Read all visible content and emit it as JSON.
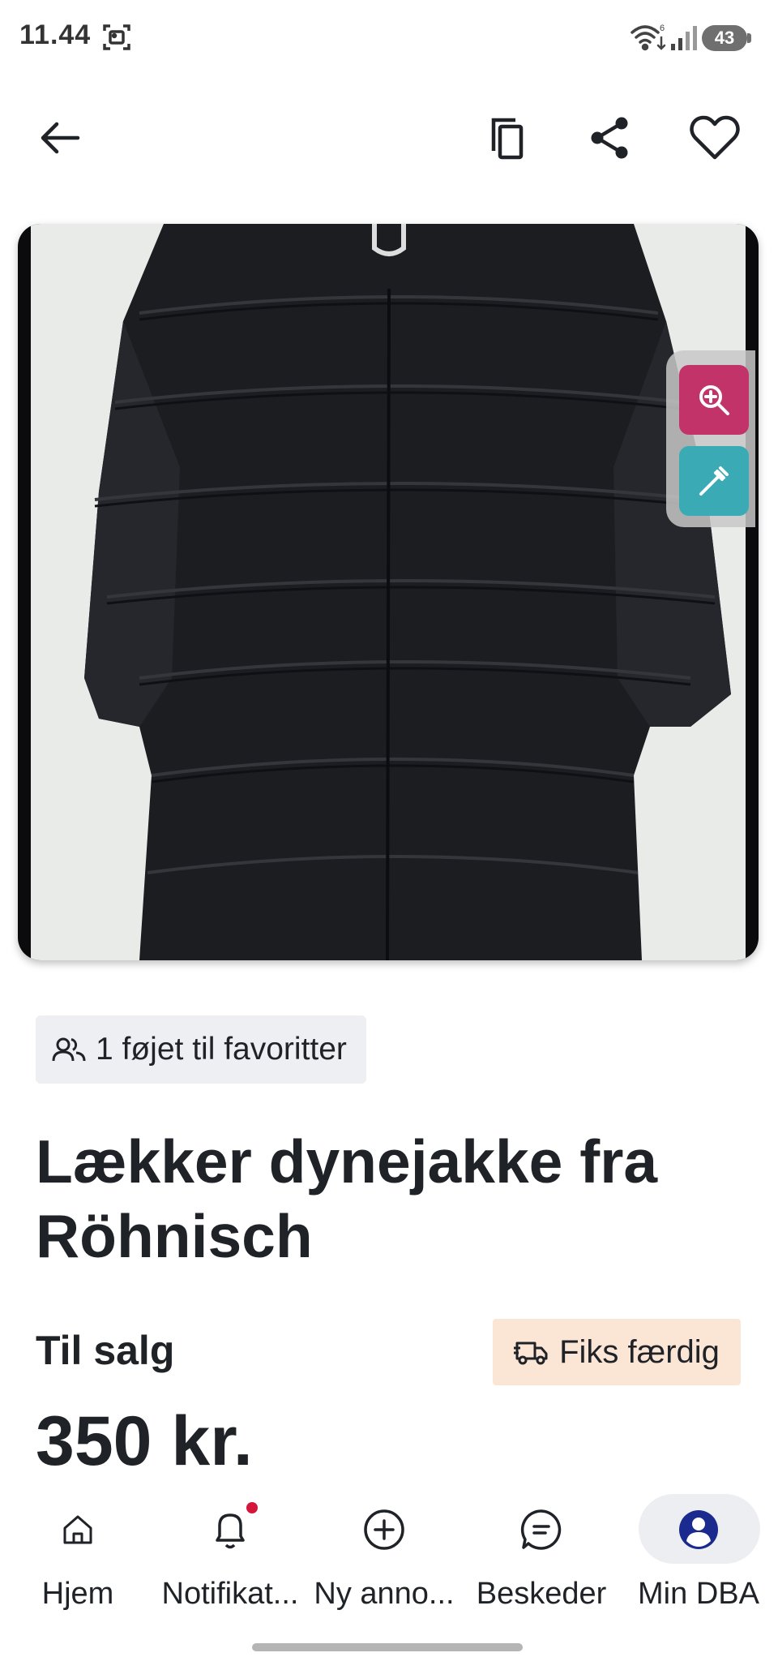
{
  "status_bar": {
    "time": "11.44",
    "battery": "43",
    "icons": [
      "screenshot-icon",
      "wifi-icon",
      "signal-icon"
    ]
  },
  "app_bar": {
    "icons": [
      "arrow-left-icon",
      "copy-icon",
      "share-icon",
      "heart-icon"
    ]
  },
  "image": {
    "subject": "black quilted down jacket",
    "tools": [
      "zoom-in-icon",
      "eyedropper-icon"
    ],
    "tool_colors": {
      "zoom": "#c2336a",
      "picker": "#3aaab5"
    }
  },
  "favorites": {
    "text": "1 føjet til favoritter",
    "icon": "users-icon"
  },
  "listing": {
    "title_line1": "Lækker dynejakke fra",
    "title_line2": "Röhnisch",
    "sale_label": "Til salg",
    "shipping_label": "Fiks færdig",
    "shipping_icon": "truck-icon",
    "price": "350 kr."
  },
  "bottom_nav": {
    "items": [
      {
        "label": "Hjem",
        "icon": "home-icon"
      },
      {
        "label": "Notifikat...",
        "icon": "bell-icon",
        "badge": true
      },
      {
        "label": "Ny anno...",
        "icon": "plus-circle-icon"
      },
      {
        "label": "Beskeder",
        "icon": "chat-icon"
      },
      {
        "label": "Min DBA",
        "icon": "user-icon",
        "active": true
      }
    ],
    "active_color": "#1b2a8f"
  }
}
